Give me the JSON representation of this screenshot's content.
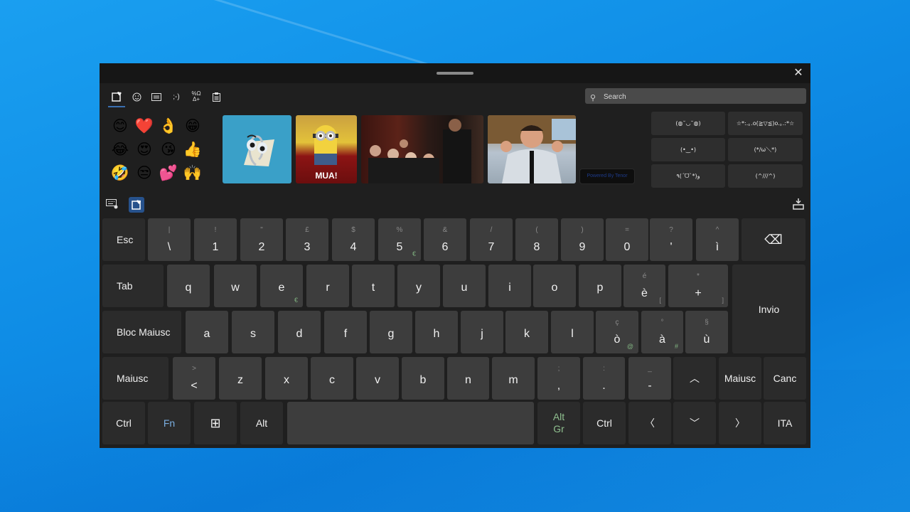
{
  "window": {
    "close_label": "✕"
  },
  "tabs": [
    {
      "name": "favorites",
      "icon": "♥",
      "active": true
    },
    {
      "name": "emoji",
      "icon": "☺",
      "active": false
    },
    {
      "name": "gif",
      "icon": "GIF",
      "active": false
    },
    {
      "name": "kaomoji",
      "icon": ";-)",
      "active": false
    },
    {
      "name": "symbols",
      "icon": "%Ω",
      "active": false
    },
    {
      "name": "clipboard",
      "icon": "📋",
      "active": false
    }
  ],
  "search": {
    "placeholder": "Search",
    "value": ""
  },
  "emojis": [
    "😊",
    "❤️",
    "👌",
    "😁",
    "😂",
    "😍",
    "😘",
    "👍",
    "🤣",
    "😒",
    "💕",
    "🙌"
  ],
  "gifs": [
    {
      "name": "clippy",
      "caption": ""
    },
    {
      "name": "minion",
      "caption": "MUA!"
    },
    {
      "name": "applause-crowd",
      "caption": ""
    },
    {
      "name": "excited-man",
      "caption": ""
    }
  ],
  "tenor_label": "Powered By Tenor",
  "kaomoji": [
    "(◍˘◡˘◍)",
    "☆*:.｡.o(≧▽≦)o.｡.:*☆",
    "(•‿•)",
    "(*/ω＼*)",
    "٩(ˊᗜˋ*)و",
    "(^///^)"
  ],
  "keyboard": {
    "layout": "ITA",
    "rows": [
      [
        {
          "main": "Esc",
          "type": "func"
        },
        {
          "shift": "|",
          "main": "\\"
        },
        {
          "shift": "!",
          "main": "1"
        },
        {
          "shift": "\"",
          "main": "2"
        },
        {
          "shift": "£",
          "main": "3"
        },
        {
          "shift": "$",
          "main": "4"
        },
        {
          "shift": "%",
          "main": "5",
          "alt": "€"
        },
        {
          "shift": "&",
          "main": "6"
        },
        {
          "shift": "/",
          "main": "7"
        },
        {
          "shift": "(",
          "main": "8"
        },
        {
          "shift": ")",
          "main": "9"
        },
        {
          "shift": "=",
          "main": "0"
        },
        {
          "shift": "?",
          "main": "'"
        },
        {
          "shift": "^",
          "main": "ì"
        },
        {
          "main": "⌫",
          "type": "func",
          "name": "backspace"
        }
      ],
      [
        {
          "main": "Tab",
          "type": "func"
        },
        {
          "main": "q"
        },
        {
          "main": "w"
        },
        {
          "main": "e",
          "alt": "€"
        },
        {
          "main": "r"
        },
        {
          "main": "t"
        },
        {
          "main": "y"
        },
        {
          "main": "u"
        },
        {
          "main": "i"
        },
        {
          "main": "o"
        },
        {
          "main": "p"
        },
        {
          "shift": "é",
          "main": "è",
          "altr": "["
        },
        {
          "shift": "*",
          "main": "+",
          "altr": "]"
        },
        {
          "main": "Invio",
          "type": "func"
        }
      ],
      [
        {
          "main": "Bloc Maiusc",
          "type": "func"
        },
        {
          "main": "a"
        },
        {
          "main": "s"
        },
        {
          "main": "d"
        },
        {
          "main": "f"
        },
        {
          "main": "g"
        },
        {
          "main": "h"
        },
        {
          "main": "j"
        },
        {
          "main": "k"
        },
        {
          "main": "l"
        },
        {
          "shift": "ç",
          "main": "ò",
          "alt": "@"
        },
        {
          "shift": "°",
          "main": "à",
          "alt": "#"
        },
        {
          "shift": "§",
          "main": "ù"
        }
      ],
      [
        {
          "main": "Maiusc",
          "type": "func"
        },
        {
          "shift": ">",
          "main": "<"
        },
        {
          "main": "z"
        },
        {
          "main": "x"
        },
        {
          "main": "c"
        },
        {
          "main": "v"
        },
        {
          "main": "b"
        },
        {
          "main": "n"
        },
        {
          "main": "m"
        },
        {
          "shift": ";",
          "main": ","
        },
        {
          "shift": ":",
          "main": "."
        },
        {
          "shift": "_",
          "main": "-"
        },
        {
          "main": "︿",
          "type": "func",
          "name": "up"
        },
        {
          "main": "Maiusc",
          "type": "func"
        },
        {
          "main": "Canc",
          "type": "func"
        }
      ],
      [
        {
          "main": "Ctrl",
          "type": "func"
        },
        {
          "main": "Fn",
          "type": "func",
          "color": "#7aaee0"
        },
        {
          "main": "⊞",
          "type": "func",
          "name": "windows"
        },
        {
          "main": "Alt",
          "type": "func"
        },
        {
          "main": "",
          "name": "space"
        },
        {
          "main": "Alt\nGr",
          "type": "func",
          "color": "#8fbf8f"
        },
        {
          "main": "Ctrl",
          "type": "func"
        },
        {
          "main": "〈",
          "type": "func",
          "name": "left"
        },
        {
          "main": "﹀",
          "type": "func",
          "name": "down"
        },
        {
          "main": "〉",
          "type": "func",
          "name": "right"
        },
        {
          "main": "ITA",
          "type": "func"
        }
      ]
    ]
  }
}
